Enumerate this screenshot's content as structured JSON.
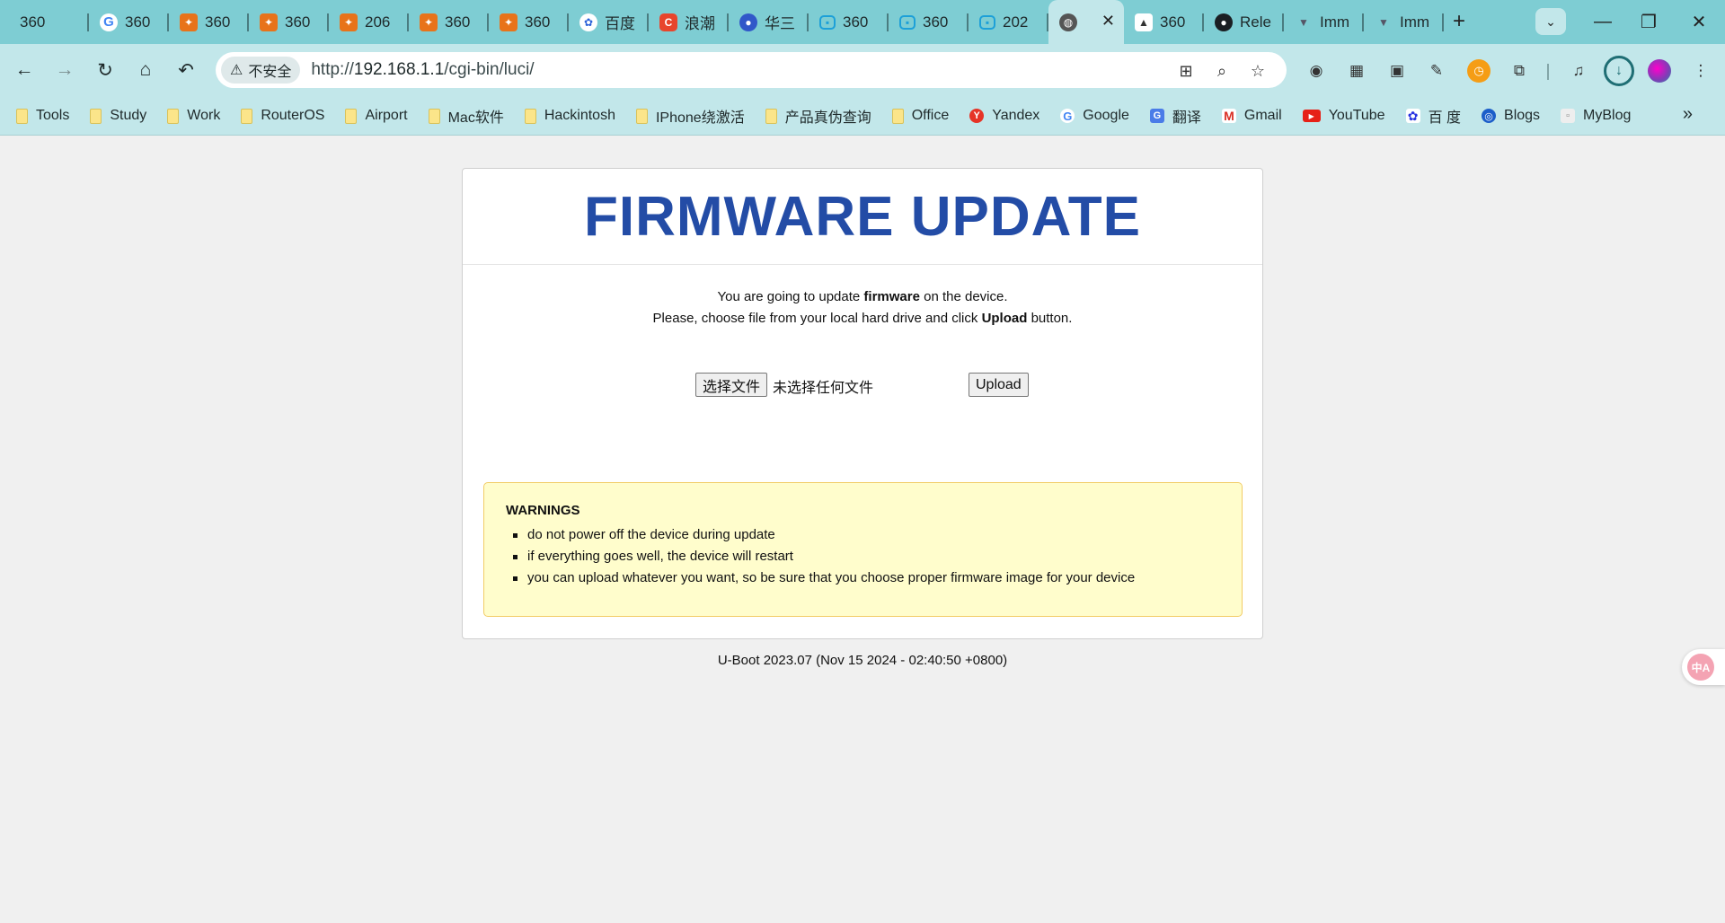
{
  "browser": {
    "tabs": [
      {
        "title": "360",
        "icon": "",
        "icon_class": "i360"
      },
      {
        "title": "360",
        "icon": "G",
        "icon_class": "g"
      },
      {
        "title": "360",
        "icon": "✦",
        "icon_class": "fire"
      },
      {
        "title": "360",
        "icon": "✦",
        "icon_class": "fire"
      },
      {
        "title": "206",
        "icon": "✦",
        "icon_class": "fire"
      },
      {
        "title": "360",
        "icon": "✦",
        "icon_class": "fire"
      },
      {
        "title": "360",
        "icon": "✦",
        "icon_class": "fire"
      },
      {
        "title": "百度",
        "icon": "✿",
        "icon_class": "baidu"
      },
      {
        "title": "浪潮",
        "icon": "C",
        "icon_class": "c"
      },
      {
        "title": "华三",
        "icon": "●",
        "icon_class": "drop"
      },
      {
        "title": "360",
        "icon": "▪",
        "icon_class": "bili"
      },
      {
        "title": "360",
        "icon": "▪",
        "icon_class": "bili"
      },
      {
        "title": "202",
        "icon": "▪",
        "icon_class": "bili"
      },
      {
        "title": "",
        "icon": "◍",
        "icon_class": "globe",
        "active": true
      },
      {
        "title": "360",
        "icon": "▲",
        "icon_class": "mount"
      },
      {
        "title": "Rele",
        "icon": "●",
        "icon_class": "gh"
      },
      {
        "title": "Imm",
        "icon": "▼",
        "icon_class": "imm"
      },
      {
        "title": "Imm",
        "icon": "▼",
        "icon_class": "imm"
      }
    ],
    "new_tab_label": "+",
    "address_bar": {
      "security_label": "不安全",
      "url_prefix": "http://",
      "url_host": "192.168.1.1",
      "url_path": "/cgi-bin/luci/"
    },
    "bookmarks": [
      {
        "label": "Tools",
        "icon_class": "folder"
      },
      {
        "label": "Study",
        "icon_class": "folder"
      },
      {
        "label": "Work",
        "icon_class": "folder"
      },
      {
        "label": "RouterOS",
        "icon_class": "folder"
      },
      {
        "label": "Airport",
        "icon_class": "folder"
      },
      {
        "label": "Mac软件",
        "icon_class": "folder"
      },
      {
        "label": "Hackintosh",
        "icon_class": "folder"
      },
      {
        "label": "IPhone绕激活",
        "icon_class": "folder"
      },
      {
        "label": "产品真伪查询",
        "icon_class": "folder"
      },
      {
        "label": "Office",
        "icon_class": "folder"
      },
      {
        "label": "Yandex",
        "icon_class": "yandex",
        "icon": "Y"
      },
      {
        "label": "Google",
        "icon_class": "google",
        "icon": "G"
      },
      {
        "label": "翻译",
        "icon_class": "trans",
        "icon": "G"
      },
      {
        "label": "Gmail",
        "icon_class": "gmail",
        "icon": "M"
      },
      {
        "label": "YouTube",
        "icon_class": "yt",
        "icon": "▶"
      },
      {
        "label": "百 度",
        "icon_class": "baidu",
        "icon": "✿"
      },
      {
        "label": "Blogs",
        "icon_class": "blogs",
        "icon": "◎"
      },
      {
        "label": "MyBlog",
        "icon_class": "myblog",
        "icon": "▫"
      }
    ]
  },
  "page": {
    "title": "FIRMWARE UPDATE",
    "intro_line1_a": "You are going to update ",
    "intro_line1_bold": "firmware",
    "intro_line1_b": " on the device.",
    "intro_line2_a": "Please, choose file from your local hard drive and click ",
    "intro_line2_bold": "Upload",
    "intro_line2_b": " button.",
    "choose_file_label": "选择文件",
    "no_file_label": "未选择任何文件",
    "upload_label": "Upload",
    "warnings_title": "WARNINGS",
    "warnings": [
      "do not power off the device during update",
      "if everything goes well, the device will restart",
      "you can upload whatever you want, so be sure that you choose proper firmware image for your device"
    ],
    "footer": "U-Boot 2023.07 (Nov 15 2024 - 02:40:50 +0800)"
  },
  "colors": {
    "title": "#234ca6",
    "warning_bg": "#fffdcc",
    "warning_border": "#f2cc66",
    "chrome_teal": "#7ecdd3"
  }
}
